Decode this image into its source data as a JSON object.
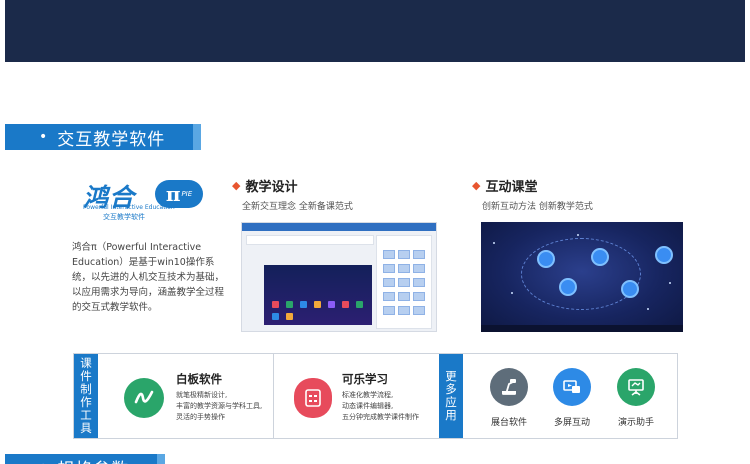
{
  "section_interactive": {
    "title": "交互教学软件"
  },
  "section_spec": {
    "title": "规格参数"
  },
  "logo": {
    "brand": "鸿合",
    "pi": "π",
    "pie": "PIE",
    "sub_en": "Powerful Interactive Education",
    "sub_cn": "交互教学软件"
  },
  "intro": {
    "text": "鸿合π（Powerful Interactive Education）是基于win10操作系统，以先进的人机交互技术为基础，以应用需求为导向，涵盖教学全过程的交互式教学软件。"
  },
  "features": [
    {
      "title": "教学设计",
      "subtitle": "全新交互理念  全新备课范式"
    },
    {
      "title": "互动课堂",
      "subtitle": "创新互动方法  创新教学范式"
    }
  ],
  "courseware_label": "课件制作工具",
  "more_apps_label": "更多应用",
  "apps": [
    {
      "name": "白板软件",
      "desc": [
        "就笔极精新设计,",
        "丰富的教学资源与学科工具,",
        "灵活的手势操作"
      ],
      "icon": "whiteboard-pen-icon",
      "color": "#2aa56a"
    },
    {
      "name": "可乐学习",
      "desc": [
        "标准化教学流程,",
        "动态课件编辑器,",
        "五分钟完成教学课件制作"
      ],
      "icon": "document-icon",
      "color": "#e74b5c"
    }
  ],
  "more_apps": [
    {
      "label": "展台软件",
      "icon": "document-camera-icon",
      "color": "#5e6d7a"
    },
    {
      "label": "多屏互动",
      "icon": "multi-screen-icon",
      "color": "#2d8ae6"
    },
    {
      "label": "演示助手",
      "icon": "presentation-board-icon",
      "color": "#2aa56a"
    }
  ]
}
